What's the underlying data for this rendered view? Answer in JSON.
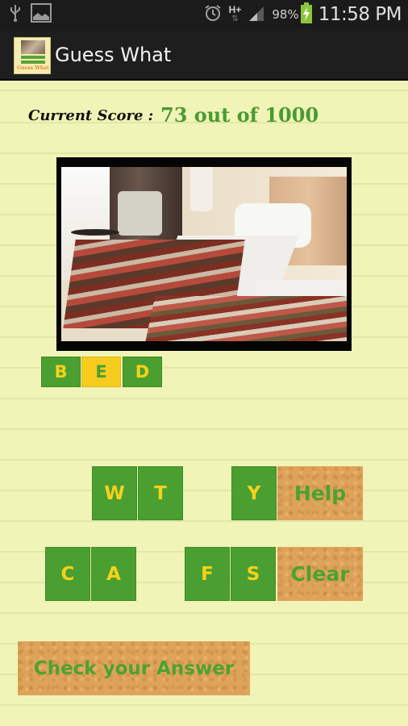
{
  "status_bar": {
    "left_icons": [
      "usb-icon",
      "image-icon"
    ],
    "right_icons": [
      "alarm-icon",
      "network-hplus-icon",
      "signal-icon",
      "battery-charging-icon"
    ],
    "network_label": "H+",
    "battery_percent": "98%",
    "time": "11:58 PM",
    "battery_color": "#8bc53f"
  },
  "action_bar": {
    "app_title": "Guess What",
    "app_icon_label": "Guess What"
  },
  "score": {
    "label": "Current Score :",
    "value": "73 out of 1000",
    "current": 73,
    "total": 1000
  },
  "puzzle_image": {
    "description": "hotel room with two beds and striped blankets"
  },
  "answer": {
    "letters": [
      {
        "char": "B",
        "highlighted": false
      },
      {
        "char": "E",
        "highlighted": true
      },
      {
        "char": "D",
        "highlighted": false
      }
    ]
  },
  "keyboard": {
    "row1": [
      "W",
      "T",
      "Y"
    ],
    "row2": [
      "C",
      "A",
      "F",
      "S"
    ]
  },
  "buttons": {
    "help": "Help",
    "clear": "Clear",
    "check": "Check your Answer"
  },
  "colors": {
    "tile_green": "#4a9f30",
    "tile_letter_yellow": "#f6d21a",
    "highlight_yellow": "#f6cc1f",
    "wood": "#dea35a",
    "button_text_green": "#4ba231",
    "score_green": "#4a9a33",
    "paper": "#f1f4b7"
  }
}
